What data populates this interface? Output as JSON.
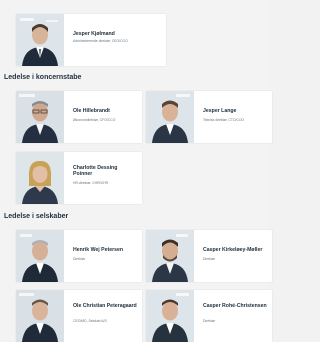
{
  "sections": [
    {
      "heading": "",
      "people": [
        {
          "name": "Jesper Kjølmand",
          "role": "Administrerende direktør, CEO/COO",
          "photo_icon": "male-portrait-icon"
        }
      ]
    },
    {
      "heading": "Ledelse i koncernstabe",
      "people": [
        {
          "name": "Ole Hillebrandt",
          "role": "Økonomidirektør, CFO/CCO",
          "photo_icon": "male-portrait-icon"
        },
        {
          "name": "Jesper Lange",
          "role": "Teknisk direktør, CTO/COO",
          "photo_icon": "male-portrait-icon"
        },
        {
          "name": "Charlotte Dessing Poinner",
          "role": "HR-direktør, CHRO/HR",
          "photo_icon": "female-portrait-icon"
        }
      ]
    },
    {
      "heading": "Ledelse i selskaber",
      "people": [
        {
          "name": "Henrik Wej Petersen",
          "role": "Direktør",
          "photo_icon": "male-portrait-icon"
        },
        {
          "name": "Casper Kirkeløey-Møller",
          "role": "Direktør",
          "photo_icon": "male-portrait-icon"
        },
        {
          "name": "Ole Christian Peteragaard",
          "role": "CEO/MD, Selskab A/S",
          "photo_icon": "male-portrait-icon"
        },
        {
          "name": "Casper Rohé-Christensen",
          "role": "Direktør",
          "photo_icon": "male-portrait-icon"
        }
      ]
    }
  ],
  "colors": {
    "background": "#f3f3f3",
    "card": "#ffffff",
    "heading_text": "#1f2f3d"
  }
}
